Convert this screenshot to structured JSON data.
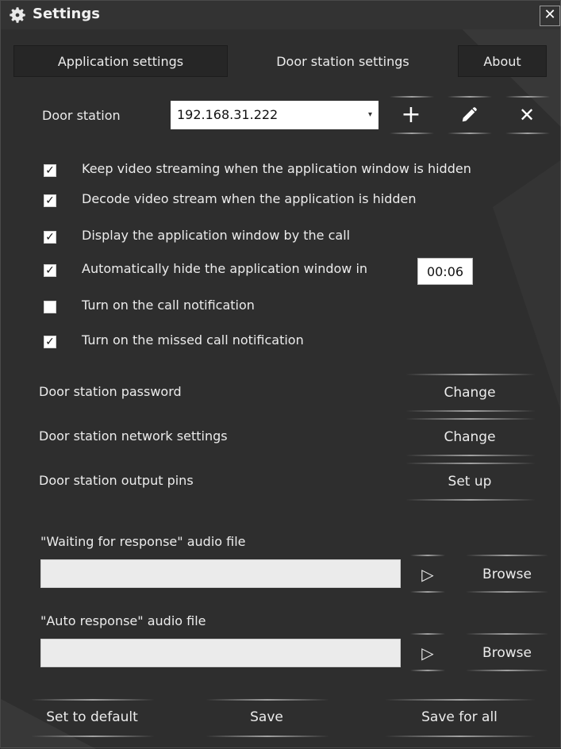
{
  "window": {
    "title": "Settings",
    "close_glyph": "✕"
  },
  "tabs": [
    {
      "label": "Application settings",
      "active": false
    },
    {
      "label": "Door station settings",
      "active": true
    },
    {
      "label": "About",
      "active": false
    }
  ],
  "door_station": {
    "label": "Door station",
    "selected": "192.168.31.222",
    "dropdown_glyph": "▾",
    "add_glyph": "+",
    "edit_icon": "pencil-icon",
    "delete_glyph": "✕"
  },
  "checkboxes": [
    {
      "label": "Keep video streaming when the application window is hidden",
      "checked": true
    },
    {
      "label": "Decode video stream when the application is hidden",
      "checked": true
    },
    {
      "label": "Display the application window by the call",
      "checked": true
    },
    {
      "label": "Automatically hide the application window in",
      "checked": true
    },
    {
      "label": "Turn on the call notification",
      "checked": false
    },
    {
      "label": "Turn on the missed call notification",
      "checked": true
    }
  ],
  "check_glyph": "✓",
  "auto_hide_time": "00:06",
  "actions": [
    {
      "label": "Door station password",
      "button": "Change"
    },
    {
      "label": "Door station network settings",
      "button": "Change"
    },
    {
      "label": "Door station output pins",
      "button": "Set up"
    }
  ],
  "audio": {
    "waiting_label": "\"Waiting for response\" audio file",
    "waiting_value": "",
    "auto_label": "\"Auto response\" audio file",
    "auto_value": "",
    "play_glyph": "▷",
    "browse_label": "Browse"
  },
  "footer": {
    "set_default": "Set to default",
    "save": "Save",
    "save_all": "Save for all"
  },
  "colors": {
    "background": "#2e2e2e",
    "text": "#ececec",
    "field": "#ffffff"
  }
}
